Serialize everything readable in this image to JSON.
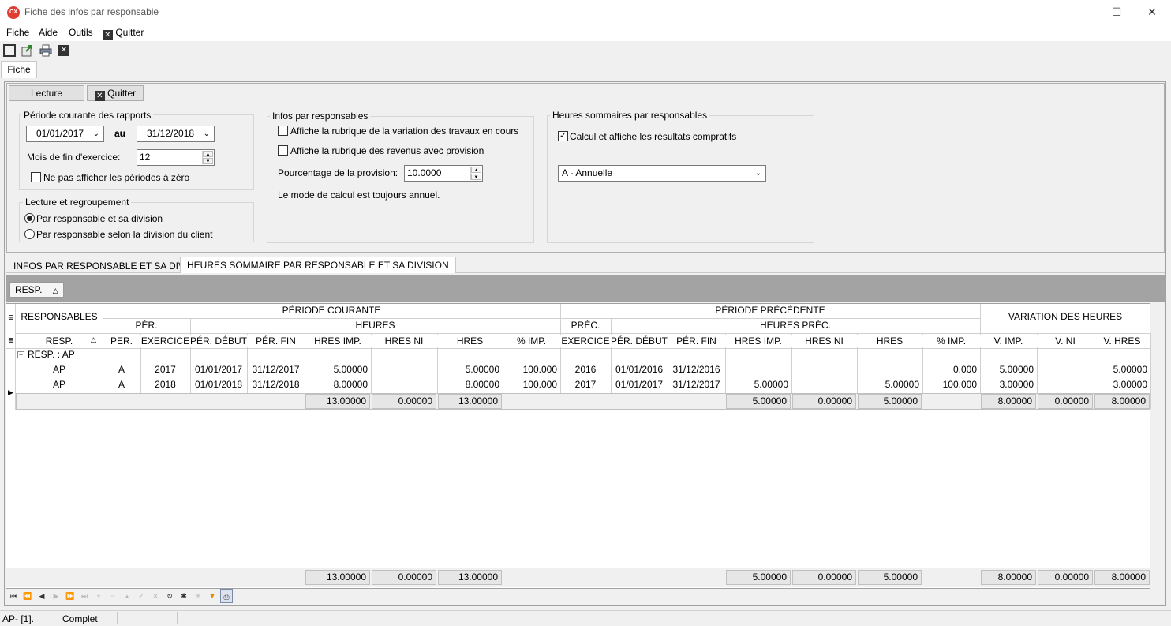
{
  "window": {
    "title": "Fiche des infos par responsable",
    "app_icon": "OX"
  },
  "menu": {
    "items": [
      "Fiche",
      "Aide",
      "Outils"
    ],
    "quit": "Quitter"
  },
  "tabs": {
    "top": "Fiche"
  },
  "buttons": {
    "lecture": "Lecture",
    "quitter": "Quitter"
  },
  "periode": {
    "legend": "Période courante des rapports",
    "from": "01/01/2017",
    "au": "au",
    "to": "31/12/2018",
    "mois_label": "Mois de fin d'exercice:",
    "mois_value": "12",
    "zero_label": "Ne pas afficher les périodes à zéro",
    "zero_checked": false
  },
  "lecture_group": {
    "legend": "Lecture et regroupement",
    "opt1": "Par responsable et sa division",
    "opt2": "Par responsable selon la division du client",
    "selected": 1
  },
  "infos": {
    "legend": "Infos par responsables",
    "chk1": "Affiche la rubrique de la variation des travaux en cours",
    "chk2": "Affiche la rubrique des revenus avec provision",
    "pct_label": "Pourcentage de la provision:",
    "pct_value": "10.0000",
    "note": "Le mode de calcul est toujours annuel."
  },
  "heures": {
    "legend": "Heures sommaires par responsables",
    "chk_label": "Calcul et affiche les résultats compratifs",
    "chk_checked": true,
    "mode": "A - Annuelle"
  },
  "grid_tabs": [
    "INFOS PAR RESPONSABLE ET SA DIVISION",
    "HEURES SOMMAIRE PAR RESPONSABLE ET SA DIVISION"
  ],
  "group_chip": "RESP.",
  "grid": {
    "bands": {
      "responsables": "RESPONSABLES",
      "periode_courante": "PÉRIODE COURANTE",
      "periode_precedente": "PÉRIODE PRÉCÉDENTE",
      "variation": "VARIATION DES HEURES",
      "per": "PÉR.",
      "heures": "HEURES",
      "prec": "PRÉC.",
      "heures_prec": "HEURES PRÉC."
    },
    "columns": [
      "RESP.",
      "PER.",
      "EXERCICE",
      "PÉR. DÉBUT",
      "PÉR. FIN",
      "HRES IMP.",
      "HRES NI",
      "HRES",
      "% IMP.",
      "EXERCICE",
      "PÉR. DÉBUT",
      "PÉR. FIN",
      "HRES IMP.",
      "HRES NI",
      "HRES",
      "% IMP.",
      "V. IMP.",
      "V. NI",
      "V. HRES"
    ],
    "group_row": "RESP. : AP",
    "rows": [
      [
        "AP",
        "A",
        "2017",
        "01/01/2017",
        "31/12/2017",
        "5.00000",
        "",
        "5.00000",
        "100.000",
        "2016",
        "01/01/2016",
        "31/12/2016",
        "",
        "",
        "",
        "0.000",
        "5.00000",
        "",
        "5.00000"
      ],
      [
        "AP",
        "A",
        "2018",
        "01/01/2018",
        "31/12/2018",
        "8.00000",
        "",
        "8.00000",
        "100.000",
        "2017",
        "01/01/2017",
        "31/12/2017",
        "5.00000",
        "",
        "5.00000",
        "100.000",
        "3.00000",
        "",
        "3.00000"
      ]
    ],
    "group_totals": {
      "hres_imp": "13.00000",
      "hres_ni": "0.00000",
      "hres": "13.00000",
      "p_hres_imp": "5.00000",
      "p_hres_ni": "0.00000",
      "p_hres": "5.00000",
      "v_imp": "8.00000",
      "v_ni": "0.00000",
      "v_hres": "8.00000"
    },
    "footer_totals": {
      "hres_imp": "13.00000",
      "hres_ni": "0.00000",
      "hres": "13.00000",
      "p_hres_imp": "5.00000",
      "p_hres_ni": "0.00000",
      "p_hres": "5.00000",
      "v_imp": "8.00000",
      "v_ni": "0.00000",
      "v_hres": "8.00000"
    }
  },
  "status": {
    "left": "AP- [1].",
    "mid": "Complet"
  }
}
